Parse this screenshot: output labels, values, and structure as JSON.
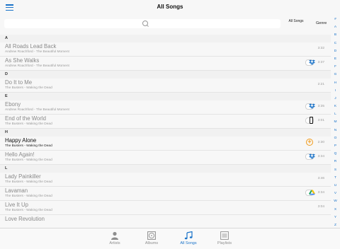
{
  "header": {
    "title": "All Songs",
    "menu_icon": "hamburger-menu-icon"
  },
  "search": {
    "placeholder": ""
  },
  "segments": {
    "all_songs": "All Songs",
    "genre": "Genre"
  },
  "colors": {
    "accent": "#1a73c9",
    "cloud": "#f09a19"
  },
  "sections": [
    {
      "letter": "A",
      "songs": [
        {
          "title": "All Roads Lead Back",
          "subtitle": "Andrew Roachford - The Beautiful Moment",
          "duration": "3:32",
          "source": "none",
          "active": false
        },
        {
          "title": "As She Walks",
          "subtitle": "Andrew Roachford - The Beautiful Moment",
          "duration": "3:37",
          "source": "dropbox",
          "active": false
        }
      ]
    },
    {
      "letter": "D",
      "songs": [
        {
          "title": "Do It to Me",
          "subtitle": "The Busters - Waking the Dead",
          "duration": "2:21",
          "source": "none",
          "active": false
        }
      ]
    },
    {
      "letter": "E",
      "songs": [
        {
          "title": "Ebony",
          "subtitle": "Andrew Roachford - The Beautiful Moment",
          "duration": "3:35",
          "source": "dropbox",
          "active": false
        },
        {
          "title": "End of the World",
          "subtitle": "The Busters - Waking the Dead",
          "duration": "3:01",
          "source": "device",
          "active": false
        }
      ]
    },
    {
      "letter": "H",
      "songs": [
        {
          "title": "Happy Alone",
          "subtitle": "The Busters - Waking the Dead",
          "duration": "2:30",
          "source": "cloud",
          "active": true
        },
        {
          "title": "Hello Again!",
          "subtitle": "The Busters - Waking the Dead",
          "duration": "3:34",
          "source": "dropbox",
          "active": false
        }
      ]
    },
    {
      "letter": "L",
      "songs": [
        {
          "title": "Lady Painkiller",
          "subtitle": "The Busters - Waking the Dead",
          "duration": "3:46",
          "source": "none",
          "active": false
        },
        {
          "title": "Lavaman",
          "subtitle": "The Busters - Waking the Dead",
          "duration": "3:34",
          "source": "drive",
          "active": false
        },
        {
          "title": "Live It Up",
          "subtitle": "The Busters - Waking the Dead",
          "duration": "3:04",
          "source": "none",
          "active": false
        },
        {
          "title": "Love Revolution",
          "subtitle": "",
          "duration": "",
          "source": "none",
          "active": false
        }
      ]
    }
  ],
  "index_letters": [
    "#",
    "A",
    "B",
    "C",
    "D",
    "E",
    "F",
    "G",
    "H",
    "I",
    "J",
    "K",
    "L",
    "M",
    "N",
    "O",
    "P",
    "Q",
    "R",
    "S",
    "T",
    "U",
    "V",
    "W",
    "X",
    "Y",
    "Z"
  ],
  "tabs": [
    {
      "label": "Artists",
      "icon": "person-icon",
      "active": false
    },
    {
      "label": "Albums",
      "icon": "album-icon",
      "active": false
    },
    {
      "label": "All Songs",
      "icon": "music-note-icon",
      "active": true
    },
    {
      "label": "Playlists",
      "icon": "playlist-icon",
      "active": false
    }
  ]
}
